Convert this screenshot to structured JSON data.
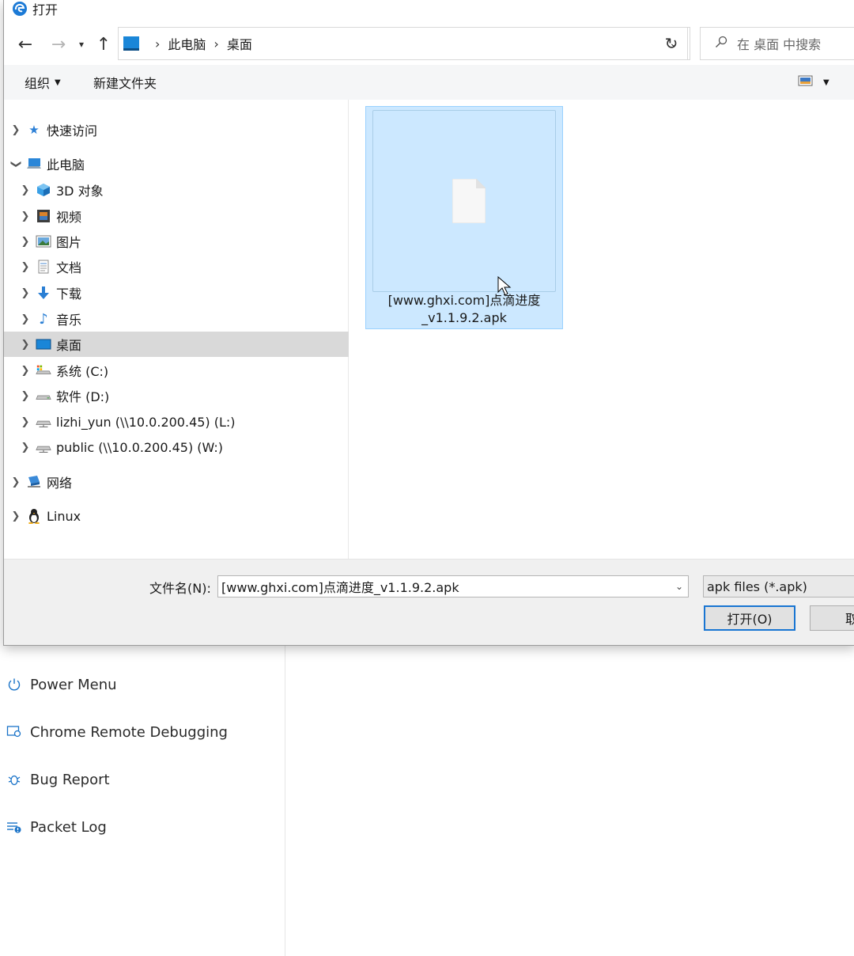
{
  "background": {
    "sidebar_items": [
      {
        "label": "Power Menu",
        "icon": "power-icon"
      },
      {
        "label": "Chrome Remote Debugging",
        "icon": "debug-icon"
      },
      {
        "label": "Bug Report",
        "icon": "bug-icon"
      },
      {
        "label": "Packet Log",
        "icon": "packet-log-icon"
      }
    ]
  },
  "dialog": {
    "title": "打开",
    "address": {
      "crumbs": [
        "此电脑",
        "桌面"
      ]
    },
    "search": {
      "placeholder": "在 桌面 中搜索"
    },
    "toolbar": {
      "organize": "组织",
      "new_folder": "新建文件夹"
    },
    "nav": {
      "items": [
        {
          "label": "快速访问",
          "icon": "star-icon",
          "level": 0,
          "expanded": false
        },
        {
          "label": "此电脑",
          "icon": "computer-icon",
          "level": 0,
          "expanded": true
        },
        {
          "label": "3D 对象",
          "icon": "cube-icon",
          "level": 1,
          "expanded": false
        },
        {
          "label": "视频",
          "icon": "film-icon",
          "level": 1,
          "expanded": false
        },
        {
          "label": "图片",
          "icon": "picture-icon",
          "level": 1,
          "expanded": false
        },
        {
          "label": "文档",
          "icon": "document-icon",
          "level": 1,
          "expanded": false
        },
        {
          "label": "下载",
          "icon": "download-icon",
          "level": 1,
          "expanded": false
        },
        {
          "label": "音乐",
          "icon": "music-icon",
          "level": 1,
          "expanded": false
        },
        {
          "label": "桌面",
          "icon": "desktop-icon",
          "level": 1,
          "expanded": false,
          "selected": true
        },
        {
          "label": "系统 (C:)",
          "icon": "drive-icon",
          "level": 1,
          "expanded": false
        },
        {
          "label": "软件 (D:)",
          "icon": "drive-icon",
          "level": 1,
          "expanded": false
        },
        {
          "label": "lizhi_yun (\\\\10.0.200.45) (L:)",
          "icon": "network-drive-icon",
          "level": 1,
          "expanded": false
        },
        {
          "label": "public (\\\\10.0.200.45) (W:)",
          "icon": "network-drive-icon",
          "level": 1,
          "expanded": false
        },
        {
          "label": "网络",
          "icon": "network-icon",
          "level": 0,
          "expanded": false
        },
        {
          "label": "Linux",
          "icon": "linux-icon",
          "level": 0,
          "expanded": false
        }
      ]
    },
    "file": {
      "name_line1": "[www.ghxi.com]点滴进度",
      "name_line2": "_v1.1.9.2.apk"
    },
    "filename": {
      "label": "文件名(N):",
      "value": "[www.ghxi.com]点滴进度_v1.1.9.2.apk"
    },
    "filetype": "apk files (*.apk)",
    "buttons": {
      "open": "打开(O)",
      "cancel": "取"
    },
    "colors": {
      "selection": "#cce8ff",
      "accent": "#1975d2"
    }
  }
}
